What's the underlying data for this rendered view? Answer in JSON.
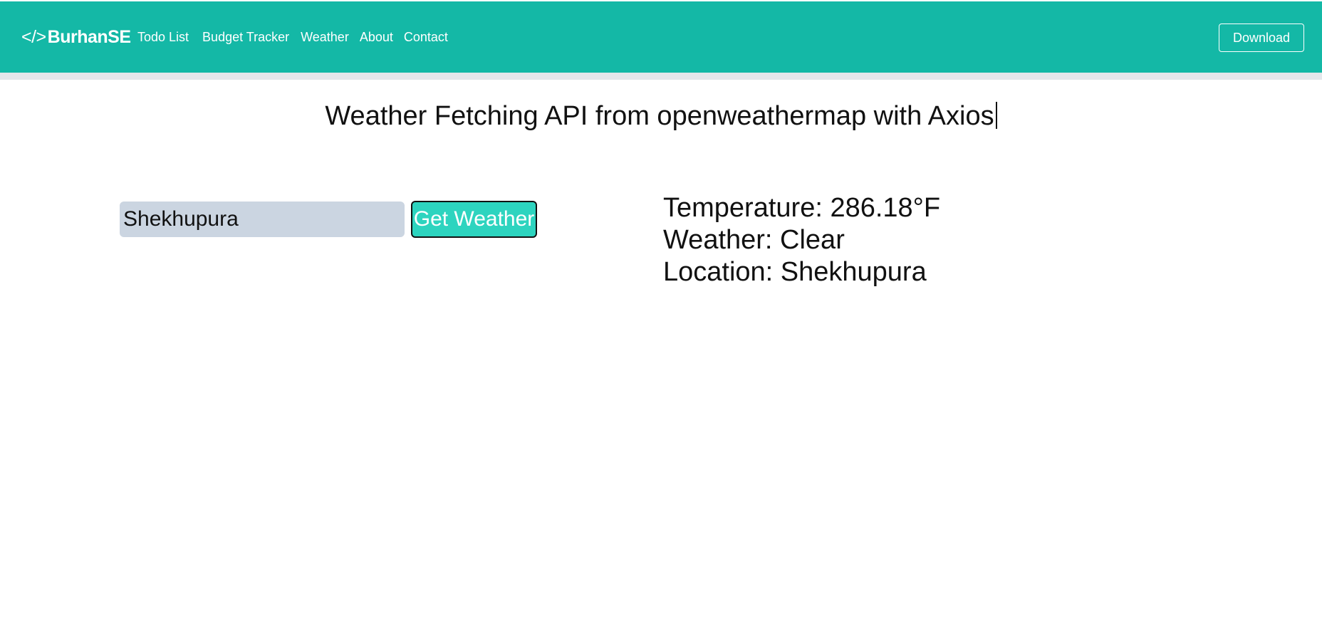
{
  "navbar": {
    "brand_icon": "</>",
    "brand_name": "BurhanSE",
    "links": [
      "Todo List",
      "Budget Tracker",
      "Weather",
      "About",
      "Contact"
    ],
    "download_label": "Download",
    "background_color": "#14b8a6"
  },
  "main": {
    "title": "Weather Fetching API from openweathermap with Axios",
    "city_input_value": "Shekhupura",
    "get_weather_label": "Get Weather",
    "results": {
      "temperature": "Temperature: 286.18°F",
      "weather": "Weather: Clear",
      "location": "Location: Shekhupura"
    }
  },
  "colors": {
    "accent": "#14b8a6",
    "button": "#2dd4bf",
    "input_bg": "#cbd5e1"
  }
}
